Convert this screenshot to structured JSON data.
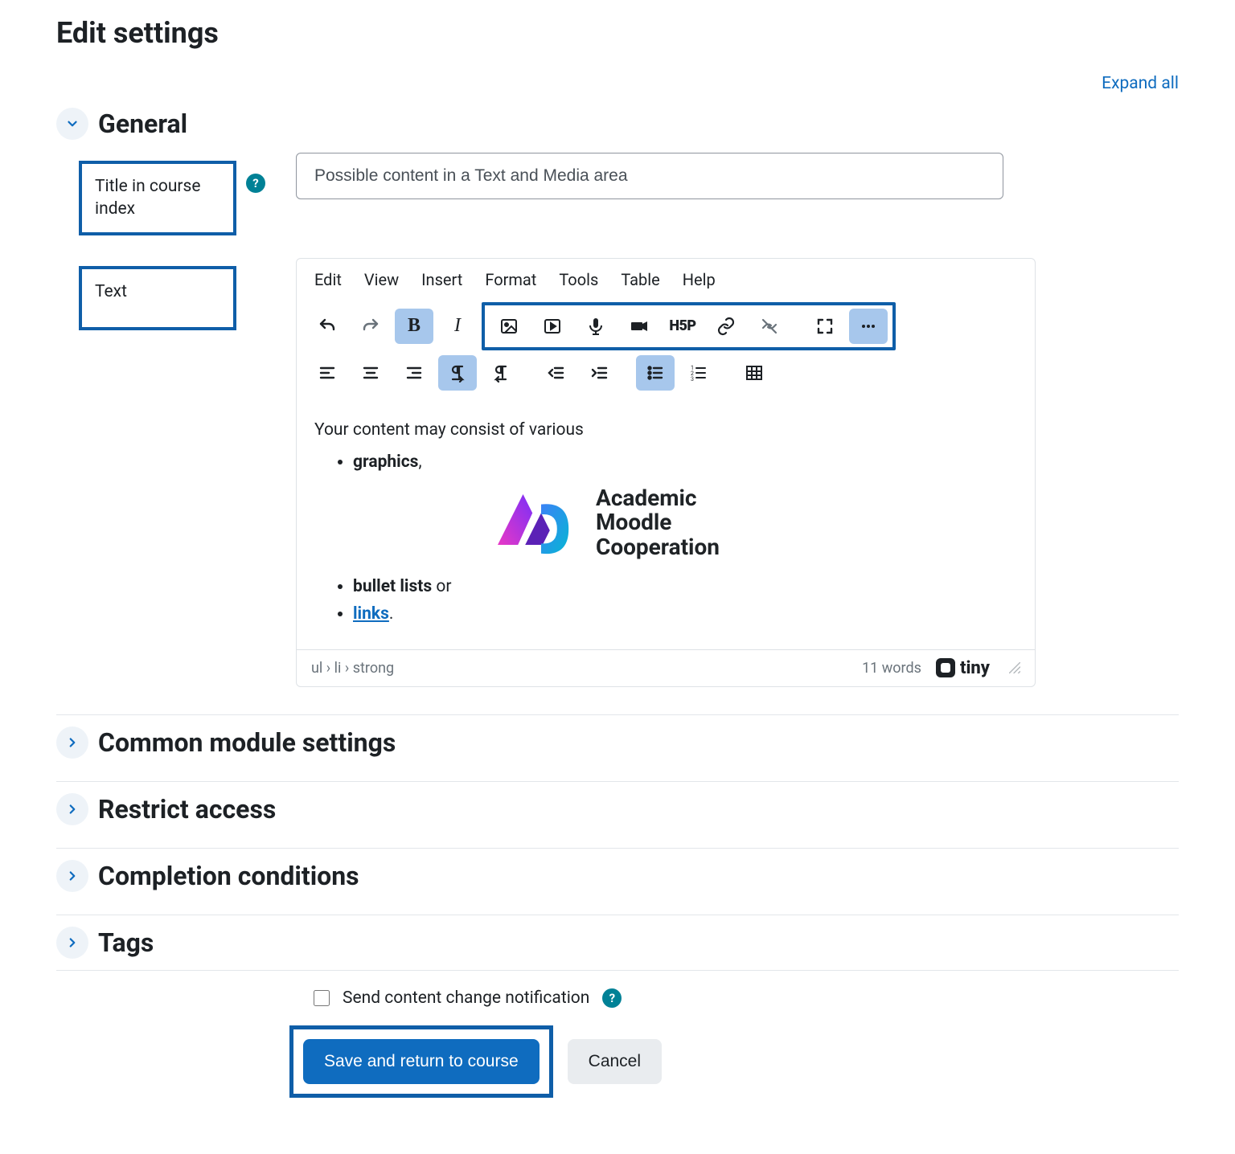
{
  "page_title": "Edit settings",
  "expand_all": "Expand all",
  "sections": {
    "general": "General",
    "common": "Common module settings",
    "restrict": "Restrict access",
    "completion": "Completion conditions",
    "tags": "Tags"
  },
  "labels": {
    "title_in_index": "Title in course index",
    "text": "Text"
  },
  "title_input_value": "Possible content in a Text and Media area",
  "editor": {
    "menu": {
      "edit": "Edit",
      "view": "View",
      "insert": "Insert",
      "format": "Format",
      "tools": "Tools",
      "table": "Table",
      "help": "Help"
    },
    "content_intro": "Your content may consist of various",
    "list": {
      "graphics": "graphics",
      "graphics_suffix": ",",
      "bullet": "bullet lists",
      "bullet_suffix": " or",
      "links": "links",
      "links_suffix": "."
    },
    "logo_text_lines": [
      "Academic",
      "Moodle",
      "Cooperation"
    ],
    "path": "ul › li › strong",
    "wordcount": "11 words",
    "brand": "tiny"
  },
  "notify": {
    "label": "Send content change notification"
  },
  "buttons": {
    "save": "Save and return to course",
    "cancel": "Cancel"
  },
  "colors": {
    "accent": "#0f6cbf",
    "highlight_border": "#0f5ea8",
    "teal": "#008196"
  }
}
